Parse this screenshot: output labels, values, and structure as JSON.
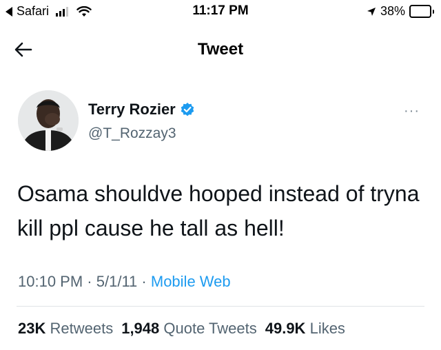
{
  "status_bar": {
    "back_app": "Safari",
    "time": "11:17 PM",
    "battery": "38%",
    "battery_level": 0.38,
    "icons": [
      "signal-icon",
      "wifi-icon",
      "location-arrow-icon",
      "battery-icon"
    ]
  },
  "nav": {
    "title": "Tweet",
    "back_icon": "arrow-left-icon"
  },
  "tweet": {
    "author": {
      "name": "Terry Rozier",
      "handle": "@T_Rozzay3",
      "verified": true,
      "avatar_icon": "avatar"
    },
    "more_label": "···",
    "text": "Osama shouldve hooped instead of tryna kill ppl cause he tall as hell!",
    "time": "10:10 PM",
    "date": "5/1/11",
    "separator": "·",
    "source": "Mobile Web",
    "stats": {
      "retweets_count": "23K",
      "retweets_label": "Retweets",
      "quotes_count": "1,948",
      "quotes_label": "Quote Tweets",
      "likes_count": "49.9K",
      "likes_label": "Likes"
    }
  },
  "colors": {
    "link": "#1d9bf0",
    "verified": "#1d9bf0",
    "secondary_text": "#536471",
    "primary_text": "#0f1419"
  }
}
